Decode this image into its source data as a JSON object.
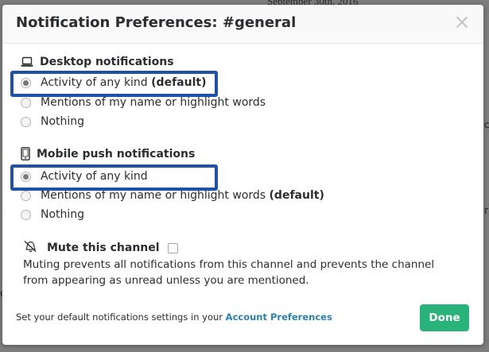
{
  "background": {
    "date_text": "September 30th, 2016",
    "fragments": [
      ".",
      "-",
      "o",
      "0",
      "c",
      "r"
    ]
  },
  "modal": {
    "title": "Notification Preferences: #general",
    "close_glyph": "×"
  },
  "desktop": {
    "heading": "Desktop notifications",
    "icon": "laptop-icon",
    "options": [
      {
        "text": "Activity of any kind",
        "suffix": "(default)",
        "checked": true
      },
      {
        "text": "Mentions of my name or highlight words",
        "suffix": "",
        "checked": false
      },
      {
        "text": "Nothing",
        "suffix": "",
        "checked": false
      }
    ]
  },
  "mobile": {
    "heading": "Mobile push notifications",
    "icon": "mobile-phone-icon",
    "options": [
      {
        "text": "Activity of any kind",
        "suffix": "",
        "checked": true
      },
      {
        "text": "Mentions of my name or highlight words",
        "suffix": "(default)",
        "checked": false
      },
      {
        "text": "Nothing",
        "suffix": "",
        "checked": false
      }
    ]
  },
  "mute": {
    "label": "Mute this channel",
    "icon": "bell-slash-icon",
    "checked": false,
    "description": "Muting prevents all notifications from this channel and prevents the channel from appearing as unread unless you are mentioned."
  },
  "footer": {
    "text": "Set your default notifications settings in your",
    "link": "Account Preferences",
    "done_label": "Done"
  },
  "colors": {
    "highlight": "#1f51a6",
    "done_button": "#2ab27b",
    "link": "#2a80b9"
  }
}
